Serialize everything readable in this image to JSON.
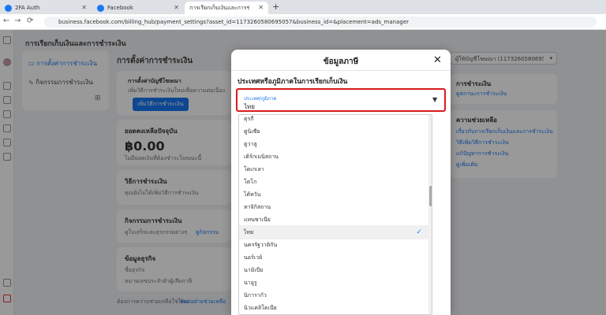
{
  "browser": {
    "tabs": [
      {
        "title": "2FA Auth",
        "icon": "facebook-icon"
      },
      {
        "title": "Facebook",
        "icon": "facebook-icon"
      },
      {
        "title": "การเรียกเก็บเงินและการชำระเงิน",
        "icon": "page-icon"
      }
    ],
    "new_tab": "+",
    "url": "business.facebook.com/billing_hub/payment_settings?asset_id=1173260580695057&business_id=&placement=ads_manager"
  },
  "page": {
    "title": "การเรียกเก็บเงินและการชำระเงิน",
    "nav": [
      "การตั้งค่าการชำระเงิน",
      "กิจกรรมการชำระเงิน"
    ],
    "content_title": "การตั้งค่าการชำระเงิน",
    "notice_title": "การตั้งค่าบัญชีโฆษณา",
    "notice_body": "เพิ่มวิธีการชำระเงินใหม่เพื่อความต่อเนื่อง",
    "notice_button": "เพิ่มวิธีการชำระเงิน",
    "balance_label": "ยอดคงเหลือปัจจุบัน",
    "balance_value": "฿0.00",
    "balance_note": "ไม่มียอดเงินที่ต้องชำระในขณะนี้",
    "payment_methods_label": "วิธีการชำระเงิน",
    "payment_methods_note": "คุณยังไม่ได้เพิ่มวิธีการชำระเงิน",
    "activity_label": "กิจกรรมการชำระเงิน",
    "activity_note": "ดูใบเสร็จและธุรกรรมต่างๆ",
    "activity_link": "ดูกิจกรรม",
    "business_label": "ข้อมูลธุรกิจ",
    "business_name_label": "ชื่อธุรกิจ",
    "business_name_value": "หมายเลขประจำตัวผู้เสียภาษี",
    "footer_note": "ต้องการความช่วยเหลือใช่ไหม",
    "footer_link": "ติดต่อฝ่ายช่วยเหลือ",
    "account_select": "ผู้ใช้บัญชีโฆษณา (1173260580695057)",
    "right_links_title": "การชำระเงิน",
    "right_link_1": "ดูสถานะการชำระเงิน",
    "help_title": "ความช่วยเหลือ",
    "help_links": [
      "เกี่ยวกับการเรียกเก็บเงินและการชำระเงิน",
      "วิธีเพิ่มวิธีการชำระเงิน",
      "แก้ปัญหาการชำระเงิน",
      "ดูเพิ่มเติม"
    ]
  },
  "modal": {
    "title": "ข้อมูลภาษี",
    "close": "✕",
    "section_label": "ประเทศหรือภูมิภาคในการเรียกเก็บเงิน",
    "field_label": "ประเทศ/ภูมิภาค",
    "field_value": "ไทย",
    "options": [
      {
        "label": "ตุรกี",
        "selected": false
      },
      {
        "label": "ตูนิเซีย",
        "selected": false
      },
      {
        "label": "ตูวาลู",
        "selected": false
      },
      {
        "label": "เติร์กเมนิสถาน",
        "selected": false
      },
      {
        "label": "โตเกเลา",
        "selected": false
      },
      {
        "label": "โตโก",
        "selected": false
      },
      {
        "label": "ไต้หวัน",
        "selected": false
      },
      {
        "label": "ทาจิกิสถาน",
        "selected": false
      },
      {
        "label": "แทนซาเนีย",
        "selected": false
      },
      {
        "label": "ไทย",
        "selected": true
      },
      {
        "label": "นครรัฐวาติกัน",
        "selected": false
      },
      {
        "label": "นอร์เวย์",
        "selected": false
      },
      {
        "label": "นามิเบีย",
        "selected": false
      },
      {
        "label": "นาอูรู",
        "selected": false
      },
      {
        "label": "นิการากัว",
        "selected": false
      },
      {
        "label": "นิวแคลิโดเนีย",
        "selected": false
      }
    ]
  },
  "colors": {
    "accent": "#1877f2",
    "highlight": "#d81b1b"
  }
}
